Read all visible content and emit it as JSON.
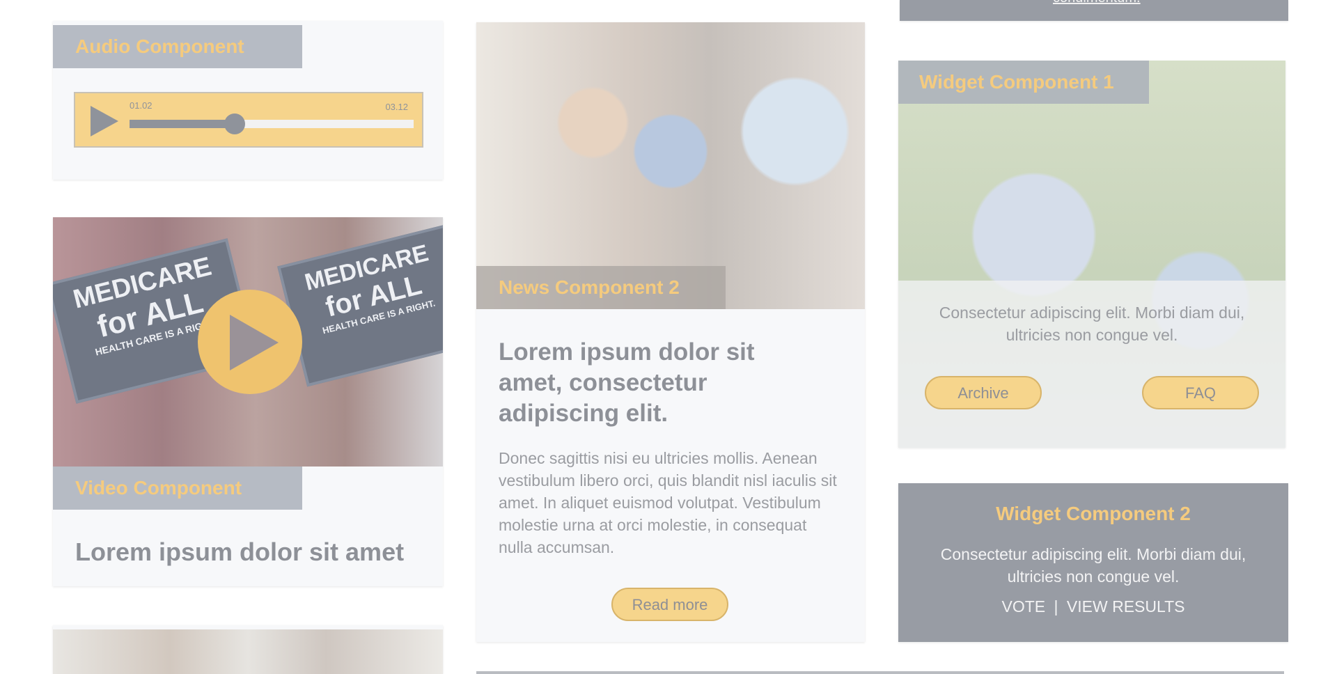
{
  "audio": {
    "tag": "Audio Component",
    "time_current": "01.02",
    "time_total": "03.12",
    "progress": 0.37
  },
  "video": {
    "tag": "Video Component",
    "title": "Lorem ipsum dolor sit amet",
    "sign_text_line1": "MEDICARE",
    "sign_text_line2": "for ALL",
    "sign_text_line3": "HEALTH CARE IS A RIGHT."
  },
  "news": {
    "tag": "News Component 2",
    "headline": "Lorem ipsum dolor sit amet, consectetur adipiscing elit.",
    "body": "Donec sagittis nisi eu ultricies mollis. Aenean vestibulum libero orci, quis blandit nisl iaculis sit amet. In aliquet euismod volutpat. Vestibulum molestie urna at orci molestie, in consequat nulla accumsan.",
    "button": "Read more"
  },
  "widget1": {
    "tag": "Widget Component 1",
    "text": "Consectetur adipiscing elit. Morbi diam dui, ultricies non congue vel.",
    "button_archive": "Archive",
    "button_faq": "FAQ"
  },
  "widget2": {
    "title": "Widget Component 2",
    "text": "Consectetur adipiscing elit. Morbi diam dui, ultricies non congue vel.",
    "vote": "VOTE",
    "separator": "|",
    "results": "VIEW RESULTS"
  },
  "top_fragment": {
    "text": "condimentum."
  },
  "colors": {
    "accent_yellow": "#f5cb7e",
    "tag_gray": "#aab0ba",
    "widget_gray": "#989ca4"
  }
}
